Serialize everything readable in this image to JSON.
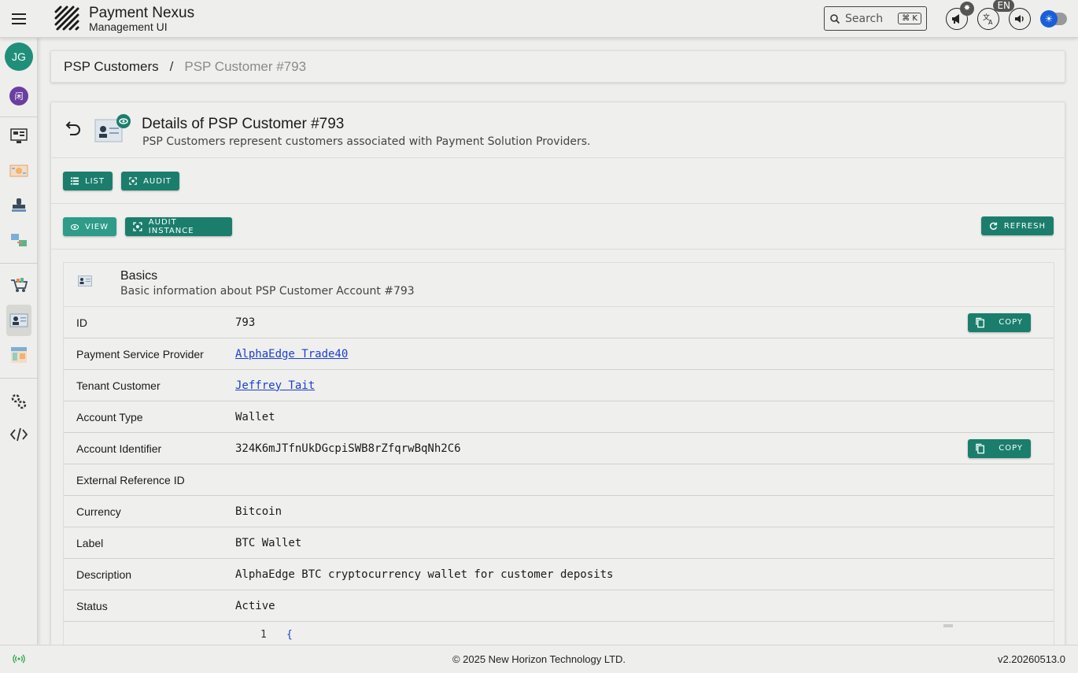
{
  "app": {
    "title": "Payment Nexus",
    "subtitle": "Management UI"
  },
  "header": {
    "search_placeholder": "Search",
    "search_shortcut": "⌘ K",
    "language": "EN",
    "icons": [
      "menu-icon",
      "megaphone-icon",
      "translate-icon",
      "volume-icon",
      "theme-toggle-icon"
    ]
  },
  "sidebar": {
    "avatar_initials": "JG",
    "tenant_initial": "闲",
    "items": [
      "dashboard-icon",
      "exchange-icon",
      "stamp-icon",
      "transfer-icon",
      "cart-icon",
      "customer-card-icon",
      "ledger-icon",
      "settings-icon",
      "code-icon"
    ]
  },
  "breadcrumb": {
    "root": "PSP Customers",
    "separator": "/",
    "current": "PSP Customer #793"
  },
  "page": {
    "title": "Details of PSP Customer #793",
    "subtitle": "PSP Customers represent customers associated with Payment Solution Providers.",
    "buttons_row1": {
      "list": "LIST",
      "audit": "AUDIT"
    },
    "buttons_row2": {
      "view": "VIEW",
      "audit_instance": "AUDIT INSTANCE",
      "refresh": "REFRESH"
    }
  },
  "basics": {
    "title": "Basics",
    "subtitle": "Basic information about PSP Customer Account #793",
    "copy_label": "COPY",
    "fields": [
      {
        "label": "ID",
        "value": "793"
      },
      {
        "label": "Payment Service Provider",
        "value": "AlphaEdge Trade40"
      },
      {
        "label": "Tenant Customer",
        "value": "Jeffrey Tait"
      },
      {
        "label": "Account Type",
        "value": "Wallet"
      },
      {
        "label": "Account Identifier",
        "value": "324K6mJTfnUkDGcpiSWB8rZfqrwBqNh2C6"
      },
      {
        "label": "External Reference ID",
        "value": ""
      },
      {
        "label": "Currency",
        "value": "Bitcoin"
      },
      {
        "label": "Label",
        "value": "BTC Wallet"
      },
      {
        "label": "Description",
        "value": "AlphaEdge BTC cryptocurrency wallet for customer deposits"
      },
      {
        "label": "Status",
        "value": "Active"
      }
    ],
    "code": {
      "line_number": "1",
      "first_line": "{"
    }
  },
  "footer": {
    "copyright": "© 2025 New Horizon Technology LTD.",
    "version": "v2.20260513.0"
  },
  "colors": {
    "primary": "#1b7e6d",
    "link": "#1a3fd0",
    "background": "#eeeeec"
  }
}
